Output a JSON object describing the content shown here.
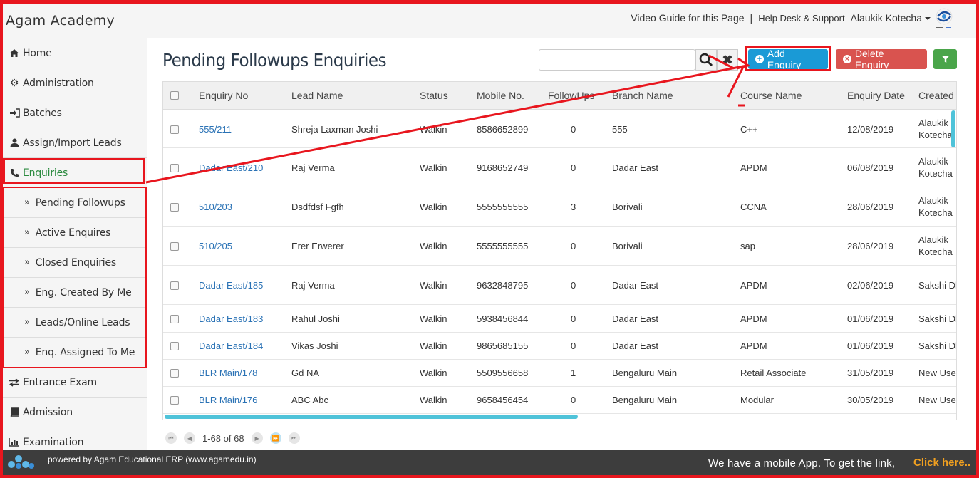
{
  "header": {
    "brand": "Agam Academy",
    "video_guide": "Video Guide for this Page",
    "separator": "|",
    "help_desk": "Help Desk & Support",
    "user": "Alaukik Kotecha"
  },
  "sidebar": {
    "items": [
      {
        "label": "Home",
        "icon": "home-icon"
      },
      {
        "label": "Administration",
        "icon": "gear-icon"
      },
      {
        "label": "Batches",
        "icon": "sign-in-icon"
      },
      {
        "label": "Assign/Import Leads",
        "icon": "user-icon"
      },
      {
        "label": "Enquiries",
        "icon": "phone-icon",
        "active": true
      },
      {
        "label": "Pending Followups",
        "sub": true
      },
      {
        "label": "Active Enquires",
        "sub": true
      },
      {
        "label": "Closed Enquiries",
        "sub": true
      },
      {
        "label": "Eng. Created By Me",
        "sub": true
      },
      {
        "label": "Leads/Online Leads",
        "sub": true
      },
      {
        "label": "Enq. Assigned To Me",
        "sub": true
      },
      {
        "label": "Entrance Exam",
        "icon": "exchange-icon"
      },
      {
        "label": "Admission",
        "icon": "book-icon"
      },
      {
        "label": "Examination",
        "icon": "chart-icon"
      }
    ]
  },
  "main": {
    "title": "Pending Followups Enquiries",
    "search_value": "",
    "add_label": "Add Enquiry",
    "delete_label": "Delete Enquiry"
  },
  "table": {
    "columns": [
      "Enquiry No",
      "Lead Name",
      "Status",
      "Mobile No.",
      "FollowUps",
      "Branch Name",
      "Course Name",
      "Enquiry Date",
      "Created"
    ],
    "rows": [
      {
        "no": "555/211",
        "lead": "Shreja Laxman Joshi",
        "status": "Walkin",
        "mobile": "8586652899",
        "fu": "0",
        "branch": "555",
        "course": "C++",
        "date": "12/08/2019",
        "created1": "Alaukik",
        "created2": "Kotecha"
      },
      {
        "no": "Dadar East/210",
        "lead": "Raj Verma",
        "status": "Walkin",
        "mobile": "9168652749",
        "fu": "0",
        "branch": "Dadar East",
        "course": "APDM",
        "date": "06/08/2019",
        "created1": "Alaukik",
        "created2": "Kotecha"
      },
      {
        "no": "510/203",
        "lead": "Dsdfdsf Fgfh",
        "status": "Walkin",
        "mobile": "5555555555",
        "fu": "3",
        "branch": "Borivali",
        "course": "CCNA",
        "date": "28/06/2019",
        "created1": "Alaukik",
        "created2": "Kotecha"
      },
      {
        "no": "510/205",
        "lead": "Erer Erwerer",
        "status": "Walkin",
        "mobile": "5555555555",
        "fu": "0",
        "branch": "Borivali",
        "course": "sap",
        "date": "28/06/2019",
        "created1": "Alaukik",
        "created2": "Kotecha"
      },
      {
        "no": "Dadar East/185",
        "lead": "Raj Verma",
        "status": "Walkin",
        "mobile": "9632848795",
        "fu": "0",
        "branch": "Dadar East",
        "course": "APDM",
        "date": "02/06/2019",
        "created1": "Sakshi Dh",
        "created2": ""
      },
      {
        "no": "Dadar East/183",
        "lead": "Rahul Joshi",
        "status": "Walkin",
        "mobile": "5938456844",
        "fu": "0",
        "branch": "Dadar East",
        "course": "APDM",
        "date": "01/06/2019",
        "created1": "Sakshi Dh",
        "created2": ""
      },
      {
        "no": "Dadar East/184",
        "lead": "Vikas Joshi",
        "status": "Walkin",
        "mobile": "9865685155",
        "fu": "0",
        "branch": "Dadar East",
        "course": "APDM",
        "date": "01/06/2019",
        "created1": "Sakshi Dh",
        "created2": ""
      },
      {
        "no": "BLR Main/178",
        "lead": "Gd NA",
        "status": "Walkin",
        "mobile": "5509556658",
        "fu": "1",
        "branch": "Bengaluru Main",
        "course": "Retail Associate",
        "date": "31/05/2019",
        "created1": "New User",
        "created2": ""
      },
      {
        "no": "BLR Main/176",
        "lead": "ABC Abc",
        "status": "Walkin",
        "mobile": "9658456454",
        "fu": "0",
        "branch": "Bengaluru Main",
        "course": "Modular",
        "date": "30/05/2019",
        "created1": "New User",
        "created2": ""
      }
    ]
  },
  "pager": {
    "info": "1-68 of 68"
  },
  "footer": {
    "powered": "powered by Agam Educational ERP (www.agamedu.in)",
    "mobile_text": "We have a mobile App. To get the link,",
    "click_text": "Click here.."
  },
  "colors": {
    "accent_red": "#e8161e",
    "add_blue": "#1a9ad6",
    "delete_red": "#d9534f",
    "filter_green": "#4aa54a",
    "link_blue": "#2a72b5",
    "active_green": "#2a8a3e"
  }
}
